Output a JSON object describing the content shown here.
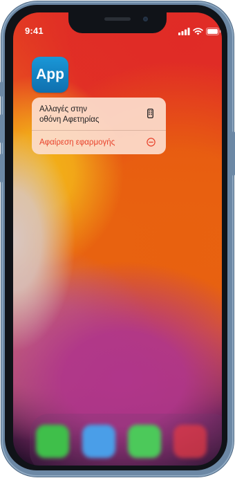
{
  "status_bar": {
    "time": "9:41"
  },
  "home_screen": {
    "app_icon_label": "App",
    "app_icon_color": "#1a8ccb"
  },
  "context_menu": {
    "items": [
      {
        "label": "Αλλαγές στην\nοθόνη Αφετηρίας",
        "icon": "phone-screen-icon",
        "destructive": false
      },
      {
        "label": "Αφαίρεση εφαρμογής",
        "icon": "minus-circle-icon",
        "destructive": true
      }
    ]
  },
  "dock": {
    "apps": [
      {
        "icon": "phone-app-icon",
        "color": "#3fbf4a"
      },
      {
        "icon": "safari-app-icon",
        "color": "#4a9ee8"
      },
      {
        "icon": "messages-app-icon",
        "color": "#4cc95a"
      },
      {
        "icon": "music-app-icon",
        "color": "#f0384e"
      }
    ]
  },
  "colors": {
    "destructive": "#e8402a",
    "menu_background": "#fcddcc",
    "frame": "#6c88a5"
  }
}
